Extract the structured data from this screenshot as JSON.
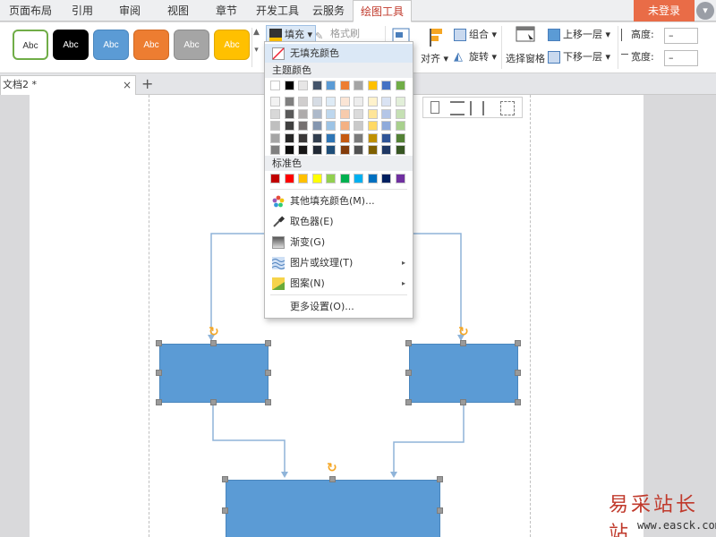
{
  "tabs": [
    "页面布局",
    "引用",
    "审阅",
    "视图",
    "章节",
    "开发工具",
    "云服务",
    "绘图工具"
  ],
  "active_tab": "绘图工具",
  "login_label": "未登录",
  "menu_icon": "chevron-down-icon",
  "ribbon": {
    "style_gallery": [
      {
        "label": "Abc",
        "bg": "#ffffff",
        "border": "#70ad47",
        "color": "#333333"
      },
      {
        "label": "Abc",
        "bg": "#000000",
        "border": "#000000",
        "color": "#ffffff"
      },
      {
        "label": "Abc",
        "bg": "#5b9bd5",
        "border": "#4a86bd",
        "color": "#ffffff"
      },
      {
        "label": "Abc",
        "bg": "#ed7d31",
        "border": "#d06a25",
        "color": "#ffffff"
      },
      {
        "label": "Abc",
        "bg": "#a5a5a5",
        "border": "#8c8c8c",
        "color": "#ffffff"
      },
      {
        "label": "Abc",
        "bg": "#ffc000",
        "border": "#e0a800",
        "color": "#ffffff"
      }
    ],
    "fill_label": "填充",
    "format_brush_label": "格式刷",
    "align_label": "对齐",
    "group_label": "组合",
    "rotate_label": "旋转",
    "select_pane_label": "选择窗格",
    "bring_forward_label": "上移一层",
    "send_backward_label": "下移一层",
    "height_label": "高度:",
    "width_label": "宽度:",
    "height_value": "–",
    "width_value": "–"
  },
  "doc_tab": {
    "title": "文档2 *",
    "close": "×",
    "add": "+"
  },
  "fill_menu": {
    "no_fill": "无填充颜色",
    "theme_header": "主题颜色",
    "theme_colors": [
      "#ffffff",
      "#000000",
      "#e7e6e6",
      "#44546a",
      "#5b9bd5",
      "#ed7d31",
      "#a5a5a5",
      "#ffc000",
      "#4472c4",
      "#70ad47"
    ],
    "theme_shades": [
      [
        "#f2f2f2",
        "#7f7f7f",
        "#d0cece",
        "#d6dce4",
        "#deebf6",
        "#fbe5d5",
        "#ededed",
        "#fff2cc",
        "#dae3f3",
        "#e2efd9"
      ],
      [
        "#d8d8d8",
        "#595959",
        "#aeabab",
        "#adb9ca",
        "#bdd7ee",
        "#f7cbac",
        "#dbdbdb",
        "#fee599",
        "#b4c6e7",
        "#c5e0b3"
      ],
      [
        "#bfbfbf",
        "#3f3f3f",
        "#757070",
        "#8496b0",
        "#9cc3e5",
        "#f4b183",
        "#c9c9c9",
        "#ffd965",
        "#8eaadb",
        "#a8d08d"
      ],
      [
        "#a5a5a5",
        "#262626",
        "#3a3838",
        "#323f4f",
        "#2e75b5",
        "#c55a11",
        "#7b7b7b",
        "#bf9000",
        "#2f5496",
        "#538135"
      ],
      [
        "#7f7f7f",
        "#0c0c0c",
        "#171616",
        "#222a35",
        "#1e4e79",
        "#833c0b",
        "#525252",
        "#7f6000",
        "#1f3864",
        "#375623"
      ]
    ],
    "standard_header": "标准色",
    "standard_colors": [
      "#c00000",
      "#ff0000",
      "#ffc000",
      "#ffff00",
      "#92d050",
      "#00b050",
      "#00b0f0",
      "#0070c0",
      "#002060",
      "#7030a0"
    ],
    "other_fill": "其他填充颜色(M)...",
    "picker": "取色器(E)",
    "gradient": "渐变(G)",
    "picture_texture": "图片或纹理(T)",
    "pattern": "图案(N)",
    "more_settings": "更多设置(O)...",
    "submenu_arrow": "▸"
  },
  "canvas": {
    "shape_fill": "#5b9bd5",
    "connector_color": "#8fb4d9",
    "rotate_icon": "↻"
  },
  "watermark": {
    "cn": "易采站长站",
    "url": "www.easck.com"
  }
}
